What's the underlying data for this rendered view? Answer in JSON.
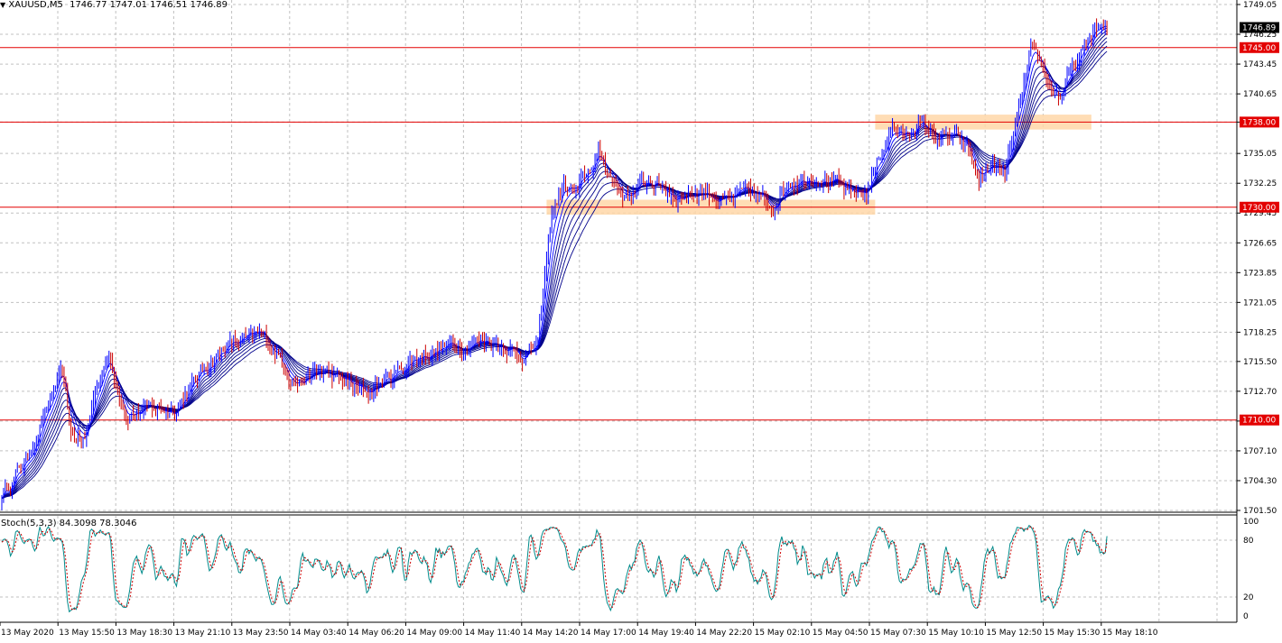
{
  "header": {
    "symbol_title": "XAUUSD,M5",
    "ohlc": "1746.77 1747.01 1746.51 1746.89"
  },
  "indicator": {
    "title": "Stoch(5,3,3) 84.3098 78.3046",
    "axis_labels": [
      "100",
      "80",
      "20",
      "0"
    ]
  },
  "price_axis": {
    "labels": [
      "1749.05",
      "1746.25",
      "1743.45",
      "1740.65",
      "1738.00",
      "1735.05",
      "1732.25",
      "1729.45",
      "1726.65",
      "1723.85",
      "1721.05",
      "1718.25",
      "1715.50",
      "1712.70",
      "1709.90",
      "1707.10",
      "1704.30",
      "1701.50"
    ],
    "current_price": "1746.89"
  },
  "levels": [
    {
      "price": 1745.0,
      "label": "1745.00"
    },
    {
      "price": 1738.0,
      "label": "1738.00"
    },
    {
      "price": 1730.0,
      "label": "1730.00"
    },
    {
      "price": 1710.0,
      "label": "1710.00"
    }
  ],
  "time_axis": {
    "labels": [
      "13 May 2020",
      "13 May 15:50",
      "13 May 18:30",
      "13 May 21:10",
      "13 May 23:50",
      "14 May 03:40",
      "14 May 06:20",
      "14 May 09:00",
      "14 May 11:40",
      "14 May 14:20",
      "14 May 17:00",
      "14 May 19:40",
      "14 May 22:20",
      "15 May 02:10",
      "15 May 04:50",
      "15 May 07:30",
      "15 May 10:10",
      "15 May 12:50",
      "15 May 15:30",
      "15 May 18:10"
    ]
  },
  "colors": {
    "level_line": "#e30000",
    "level_label_bg": "#e30000",
    "candle_up": "#0000ff",
    "candle_down": "#cc0000",
    "ma": "#00008b",
    "ma_fast": "#0000ff",
    "zone": "#ffd7a8",
    "stoch_main": "#008b8b",
    "stoch_signal": "#cc0000",
    "grid": "#c0c0c0",
    "current_label_bg": "#000000"
  },
  "zones": [
    {
      "start_index": 315,
      "end_index": 505,
      "low": 1729.3,
      "high": 1730.7
    },
    {
      "start_index": 505,
      "end_index": 630,
      "low": 1737.3,
      "high": 1738.7
    }
  ],
  "chart_data": {
    "type": "candlestick",
    "symbol": "XAUUSD,M5",
    "y_range": [
      1701.5,
      1749.05
    ],
    "anchors": [
      [
        0,
        1703.0
      ],
      [
        15,
        1706.5
      ],
      [
        30,
        1712.5
      ],
      [
        35,
        1714.5
      ],
      [
        40,
        1708.5
      ],
      [
        48,
        1708.0
      ],
      [
        55,
        1713.5
      ],
      [
        62,
        1716.0
      ],
      [
        72,
        1710.5
      ],
      [
        85,
        1711.0
      ],
      [
        100,
        1711.0
      ],
      [
        115,
        1714.5
      ],
      [
        130,
        1717.0
      ],
      [
        150,
        1718.0
      ],
      [
        160,
        1716.0
      ],
      [
        170,
        1713.5
      ],
      [
        185,
        1714.5
      ],
      [
        200,
        1713.5
      ],
      [
        210,
        1712.5
      ],
      [
        225,
        1714.0
      ],
      [
        240,
        1716.0
      ],
      [
        260,
        1717.0
      ],
      [
        280,
        1717.5
      ],
      [
        292,
        1717.0
      ],
      [
        300,
        1716.0
      ],
      [
        310,
        1717.0
      ],
      [
        318,
        1729.5
      ],
      [
        325,
        1732.0
      ],
      [
        333,
        1731.5
      ],
      [
        345,
        1735.0
      ],
      [
        352,
        1733.0
      ],
      [
        360,
        1731.0
      ],
      [
        375,
        1732.5
      ],
      [
        390,
        1731.0
      ],
      [
        405,
        1731.5
      ],
      [
        420,
        1730.5
      ],
      [
        432,
        1731.5
      ],
      [
        445,
        1730.0
      ],
      [
        455,
        1732.5
      ],
      [
        470,
        1733.0
      ],
      [
        480,
        1732.5
      ],
      [
        490,
        1731.0
      ],
      [
        500,
        1731.5
      ],
      [
        508,
        1735.0
      ],
      [
        515,
        1737.5
      ],
      [
        522,
        1736.5
      ],
      [
        530,
        1738.0
      ],
      [
        540,
        1736.5
      ],
      [
        550,
        1736.5
      ],
      [
        558,
        1735.5
      ],
      [
        565,
        1732.5
      ],
      [
        572,
        1734.0
      ],
      [
        580,
        1733.0
      ],
      [
        590,
        1740.5
      ],
      [
        595,
        1744.5
      ],
      [
        602,
        1743.0
      ],
      [
        607,
        1741.0
      ],
      [
        612,
        1740.5
      ],
      [
        618,
        1742.5
      ],
      [
        625,
        1744.5
      ],
      [
        632,
        1746.89
      ]
    ],
    "stochastic": {
      "params": "5,3,3",
      "main_last": 84.3098,
      "signal_last": 78.3046,
      "range": [
        0,
        100
      ],
      "levels": [
        80,
        20
      ]
    }
  }
}
